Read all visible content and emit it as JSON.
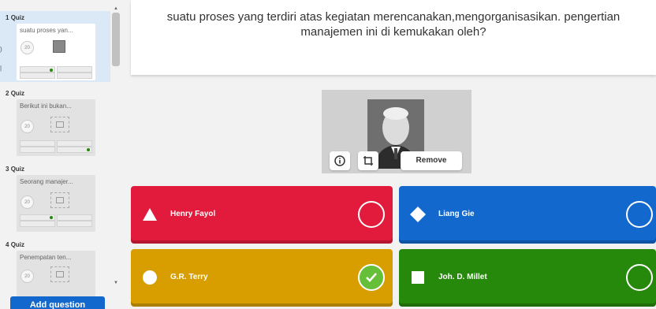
{
  "sidebar": {
    "slides": [
      {
        "number": "1",
        "type": "Quiz",
        "title": "suatu proses yan...",
        "points": "20"
      },
      {
        "number": "2",
        "type": "Quiz",
        "title": "Berikut ini bukan...",
        "points": "20"
      },
      {
        "number": "3",
        "type": "Quiz",
        "title": "Seorang manajer...",
        "points": "20"
      },
      {
        "number": "4",
        "type": "Quiz",
        "title": "Penempatan ten...",
        "points": "20"
      }
    ],
    "add_question_label": "Add question"
  },
  "question": {
    "text": "suatu proses yang terdiri atas kegiatan merencanakan,mengorganisasikan. pengertian manajemen ini di kemukakan oleh?"
  },
  "media": {
    "remove_label": "Remove",
    "info_icon": "info-icon",
    "crop_icon": "crop-icon"
  },
  "answers": [
    {
      "text": "Henry Fayol",
      "shape": "triangle",
      "color": "#e21b3c",
      "correct": false
    },
    {
      "text": "Liang Gie",
      "shape": "diamond",
      "color": "#1368ce",
      "correct": false
    },
    {
      "text": "G.R. Terry",
      "shape": "circle",
      "color": "#d89e00",
      "correct": true
    },
    {
      "text": "Joh. D. Millet",
      "shape": "square",
      "color": "#26890c",
      "correct": false
    }
  ],
  "colors": {
    "correct_check": "#66bf39",
    "accent": "#1368ce"
  }
}
